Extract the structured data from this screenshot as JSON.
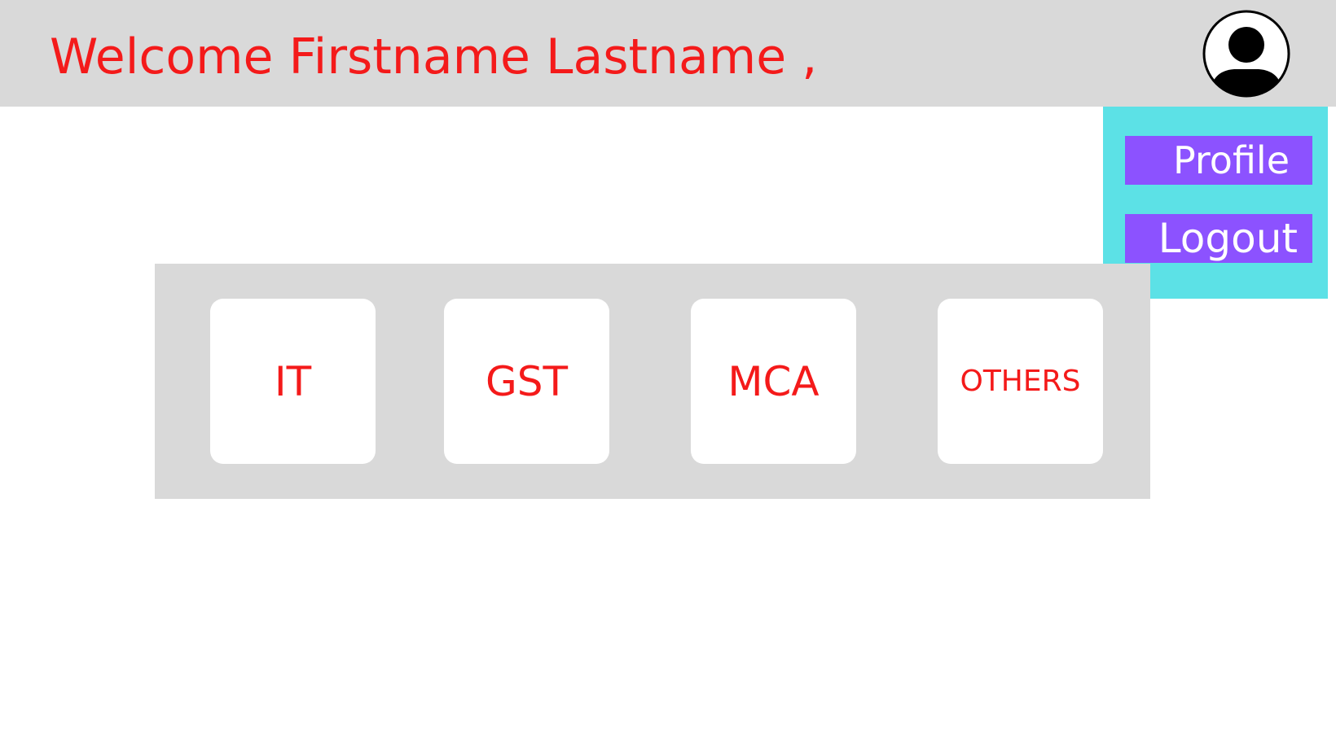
{
  "header": {
    "welcome_text": "Welcome Firstname Lastname ,",
    "avatar_icon": "user-profile-icon"
  },
  "dropdown": {
    "profile_label": "Profile",
    "logout_label": "Logout"
  },
  "categories": [
    {
      "label": "IT"
    },
    {
      "label": "GST"
    },
    {
      "label": "MCA"
    },
    {
      "label": "OTHERS"
    }
  ],
  "colors": {
    "header_bg": "#d9d9d9",
    "accent_text": "#f41a1a",
    "dropdown_bg": "#5ce1e6",
    "menu_button_bg": "#8c52ff",
    "menu_button_text": "#ffffff",
    "card_bg": "#ffffff"
  }
}
